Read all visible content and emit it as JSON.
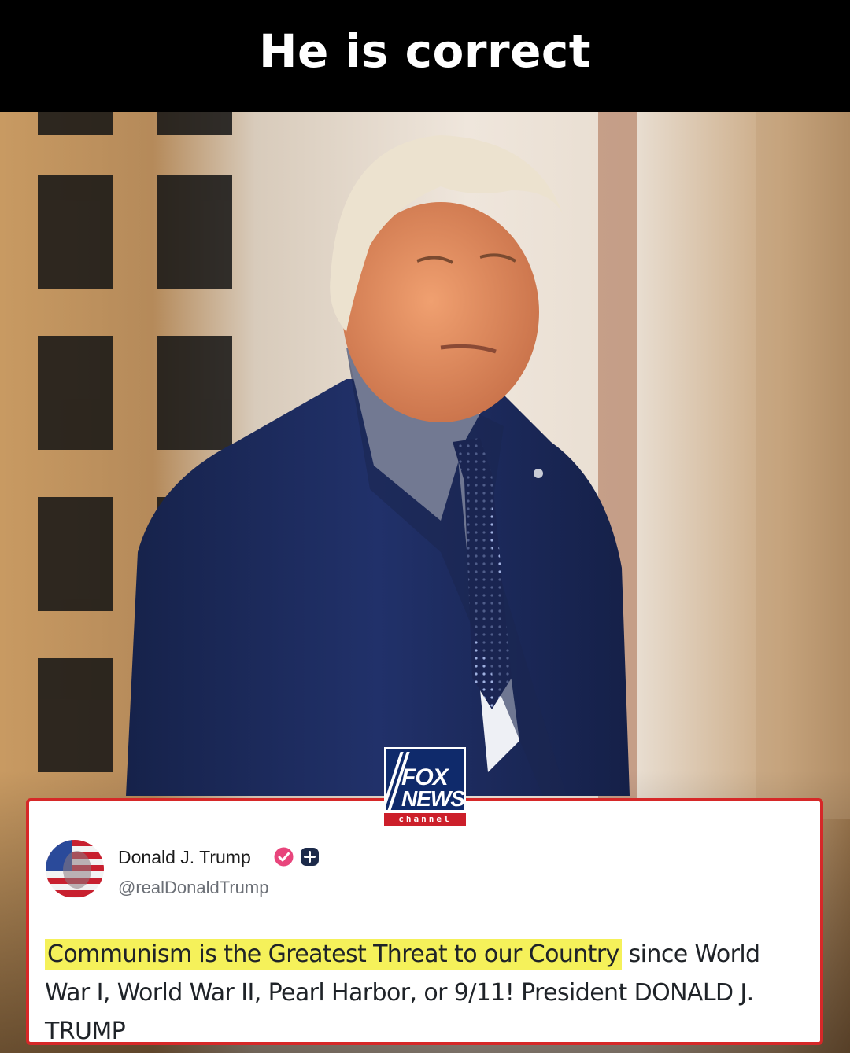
{
  "caption": {
    "text": "He is correct"
  },
  "logo": {
    "word_top": "FOX",
    "word_bottom": "NEWS",
    "channel": "channel"
  },
  "post": {
    "author_name": "Donald J. Trump",
    "author_handle": "@realDonaldTrump",
    "text_highlighted": "Communism is the Greatest Threat to our Country",
    "text_rest": " since World War I, World War II, Pearl Harbor, or 9/11! President DONALD J. TRUMP",
    "verified_icon": "verified-check-icon",
    "plus_icon": "plus-badge-icon"
  },
  "colors": {
    "card_border": "#d62828",
    "highlight": "#f5f15a",
    "fox_blue": "#0f2a6b",
    "fox_red": "#cc1f2a",
    "verified_pink": "#e8457c",
    "suit_navy": "#1d2c5a"
  }
}
